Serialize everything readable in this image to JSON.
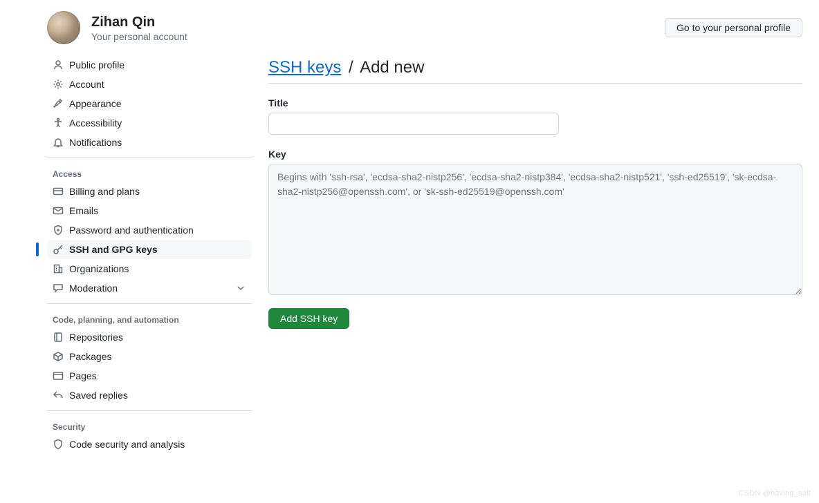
{
  "user": {
    "name": "Zihan Qin",
    "subtitle": "Your personal account"
  },
  "top_button": {
    "label": "Go to your personal profile"
  },
  "sidebar": {
    "groups": [
      {
        "title": null,
        "items": [
          {
            "icon": "person",
            "label": "Public profile",
            "active": false
          },
          {
            "icon": "gear",
            "label": "Account",
            "active": false
          },
          {
            "icon": "paintbrush",
            "label": "Appearance",
            "active": false
          },
          {
            "icon": "accessibility",
            "label": "Accessibility",
            "active": false
          },
          {
            "icon": "bell",
            "label": "Notifications",
            "active": false
          }
        ]
      },
      {
        "title": "Access",
        "items": [
          {
            "icon": "credit-card",
            "label": "Billing and plans",
            "active": false
          },
          {
            "icon": "mail",
            "label": "Emails",
            "active": false
          },
          {
            "icon": "shield-lock",
            "label": "Password and authentication",
            "active": false
          },
          {
            "icon": "key",
            "label": "SSH and GPG keys",
            "active": true
          },
          {
            "icon": "organization",
            "label": "Organizations",
            "active": false
          },
          {
            "icon": "comment",
            "label": "Moderation",
            "active": false,
            "expandable": true
          }
        ]
      },
      {
        "title": "Code, planning, and automation",
        "items": [
          {
            "icon": "repo",
            "label": "Repositories",
            "active": false
          },
          {
            "icon": "package",
            "label": "Packages",
            "active": false
          },
          {
            "icon": "browser",
            "label": "Pages",
            "active": false
          },
          {
            "icon": "reply",
            "label": "Saved replies",
            "active": false
          }
        ]
      },
      {
        "title": "Security",
        "items": [
          {
            "icon": "shield",
            "label": "Code security and analysis",
            "active": false
          }
        ]
      }
    ]
  },
  "breadcrumb": {
    "link": "SSH keys",
    "separator": "/",
    "current": "Add new"
  },
  "form": {
    "title_label": "Title",
    "title_value": "",
    "key_label": "Key",
    "key_value": "",
    "key_placeholder": "Begins with 'ssh-rsa', 'ecdsa-sha2-nistp256', 'ecdsa-sha2-nistp384', 'ecdsa-sha2-nistp521', 'ssh-ed25519', 'sk-ecdsa-sha2-nistp256@openssh.com', or 'sk-ssh-ed25519@openssh.com'",
    "submit_label": "Add SSH key"
  },
  "watermark": "CSDN @having_salt"
}
